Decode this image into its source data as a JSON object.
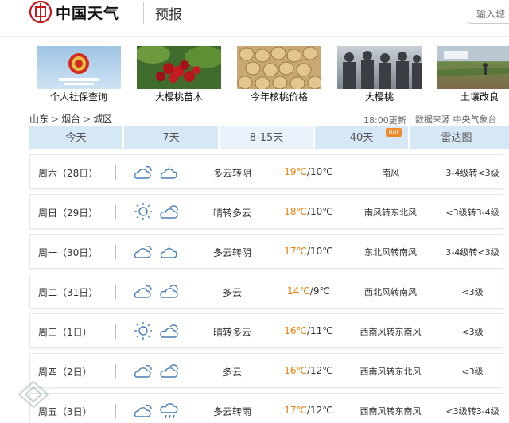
{
  "header": {
    "site_title": "中国天气",
    "section": "预报",
    "search_placeholder": "输入城"
  },
  "ads": [
    {
      "caption": "个人社保查询",
      "icon": "national-emblem-icon"
    },
    {
      "caption": "大樱桃苗木",
      "icon": "cherry-photo"
    },
    {
      "caption": "今年核桃价格",
      "icon": "walnut-photo"
    },
    {
      "caption": "大樱桃",
      "icon": "crowd-photo"
    },
    {
      "caption": "土壤改良",
      "icon": "farmland-photo"
    }
  ],
  "breadcrumb": [
    "山东",
    "烟台",
    "城区"
  ],
  "breadcrumb_sep": ">",
  "update_time": "18:00更新",
  "data_source": "数据来源 中央气象台",
  "tabs": [
    "今天",
    "7天",
    "8-15天",
    "40天",
    "雷达图"
  ],
  "active_tab": "8-15天",
  "hot_badge": "hot",
  "forecast": [
    {
      "day": "周六（28日）",
      "icons": [
        "partly-cloudy-icon",
        "cloudy-night-icon"
      ],
      "weather": "多云转阴",
      "high": "19℃",
      "low": "/10℃",
      "wind": "南风",
      "level": "3-4级转<3级"
    },
    {
      "day": "周日（29日）",
      "icons": [
        "sunny-icon",
        "cloud-icon"
      ],
      "weather": "晴转多云",
      "high": "18℃",
      "low": "/10℃",
      "wind": "南风转东北风",
      "level": "<3级转3-4级"
    },
    {
      "day": "周一（30日）",
      "icons": [
        "partly-cloudy-icon",
        "cloudy-night-icon"
      ],
      "weather": "多云转阴",
      "high": "17℃",
      "low": "/10℃",
      "wind": "东北风转南风",
      "level": "3-4级转<3级"
    },
    {
      "day": "周二（31日）",
      "icons": [
        "partly-cloudy-icon",
        "cloud-icon"
      ],
      "weather": "多云",
      "high": "14℃",
      "low": "/9℃",
      "wind": "西北风转南风",
      "level": "<3级"
    },
    {
      "day": "周三（1日）",
      "icons": [
        "sunny-icon",
        "cloud-icon"
      ],
      "weather": "晴转多云",
      "high": "16℃",
      "low": "/11℃",
      "wind": "西南风转东南风",
      "level": "<3级"
    },
    {
      "day": "周四（2日）",
      "icons": [
        "partly-cloudy-icon",
        "cloud-icon"
      ],
      "weather": "多云",
      "high": "16℃",
      "low": "/12℃",
      "wind": "西南风转东北风",
      "level": "<3级"
    },
    {
      "day": "周五（3日）",
      "icons": [
        "partly-cloudy-icon",
        "rain-cloud-icon"
      ],
      "weather": "多云转雨",
      "high": "17℃",
      "low": "/12℃",
      "wind": "西南风转东南风",
      "level": "<3级转3-4级"
    }
  ],
  "colors": {
    "tab_bg": "#d6e7f6",
    "tab_active_bg": "#eaf3fb",
    "temp_high": "#e8820c",
    "icon_stroke": "#4a7fb5",
    "logo_red": "#c8161d"
  }
}
